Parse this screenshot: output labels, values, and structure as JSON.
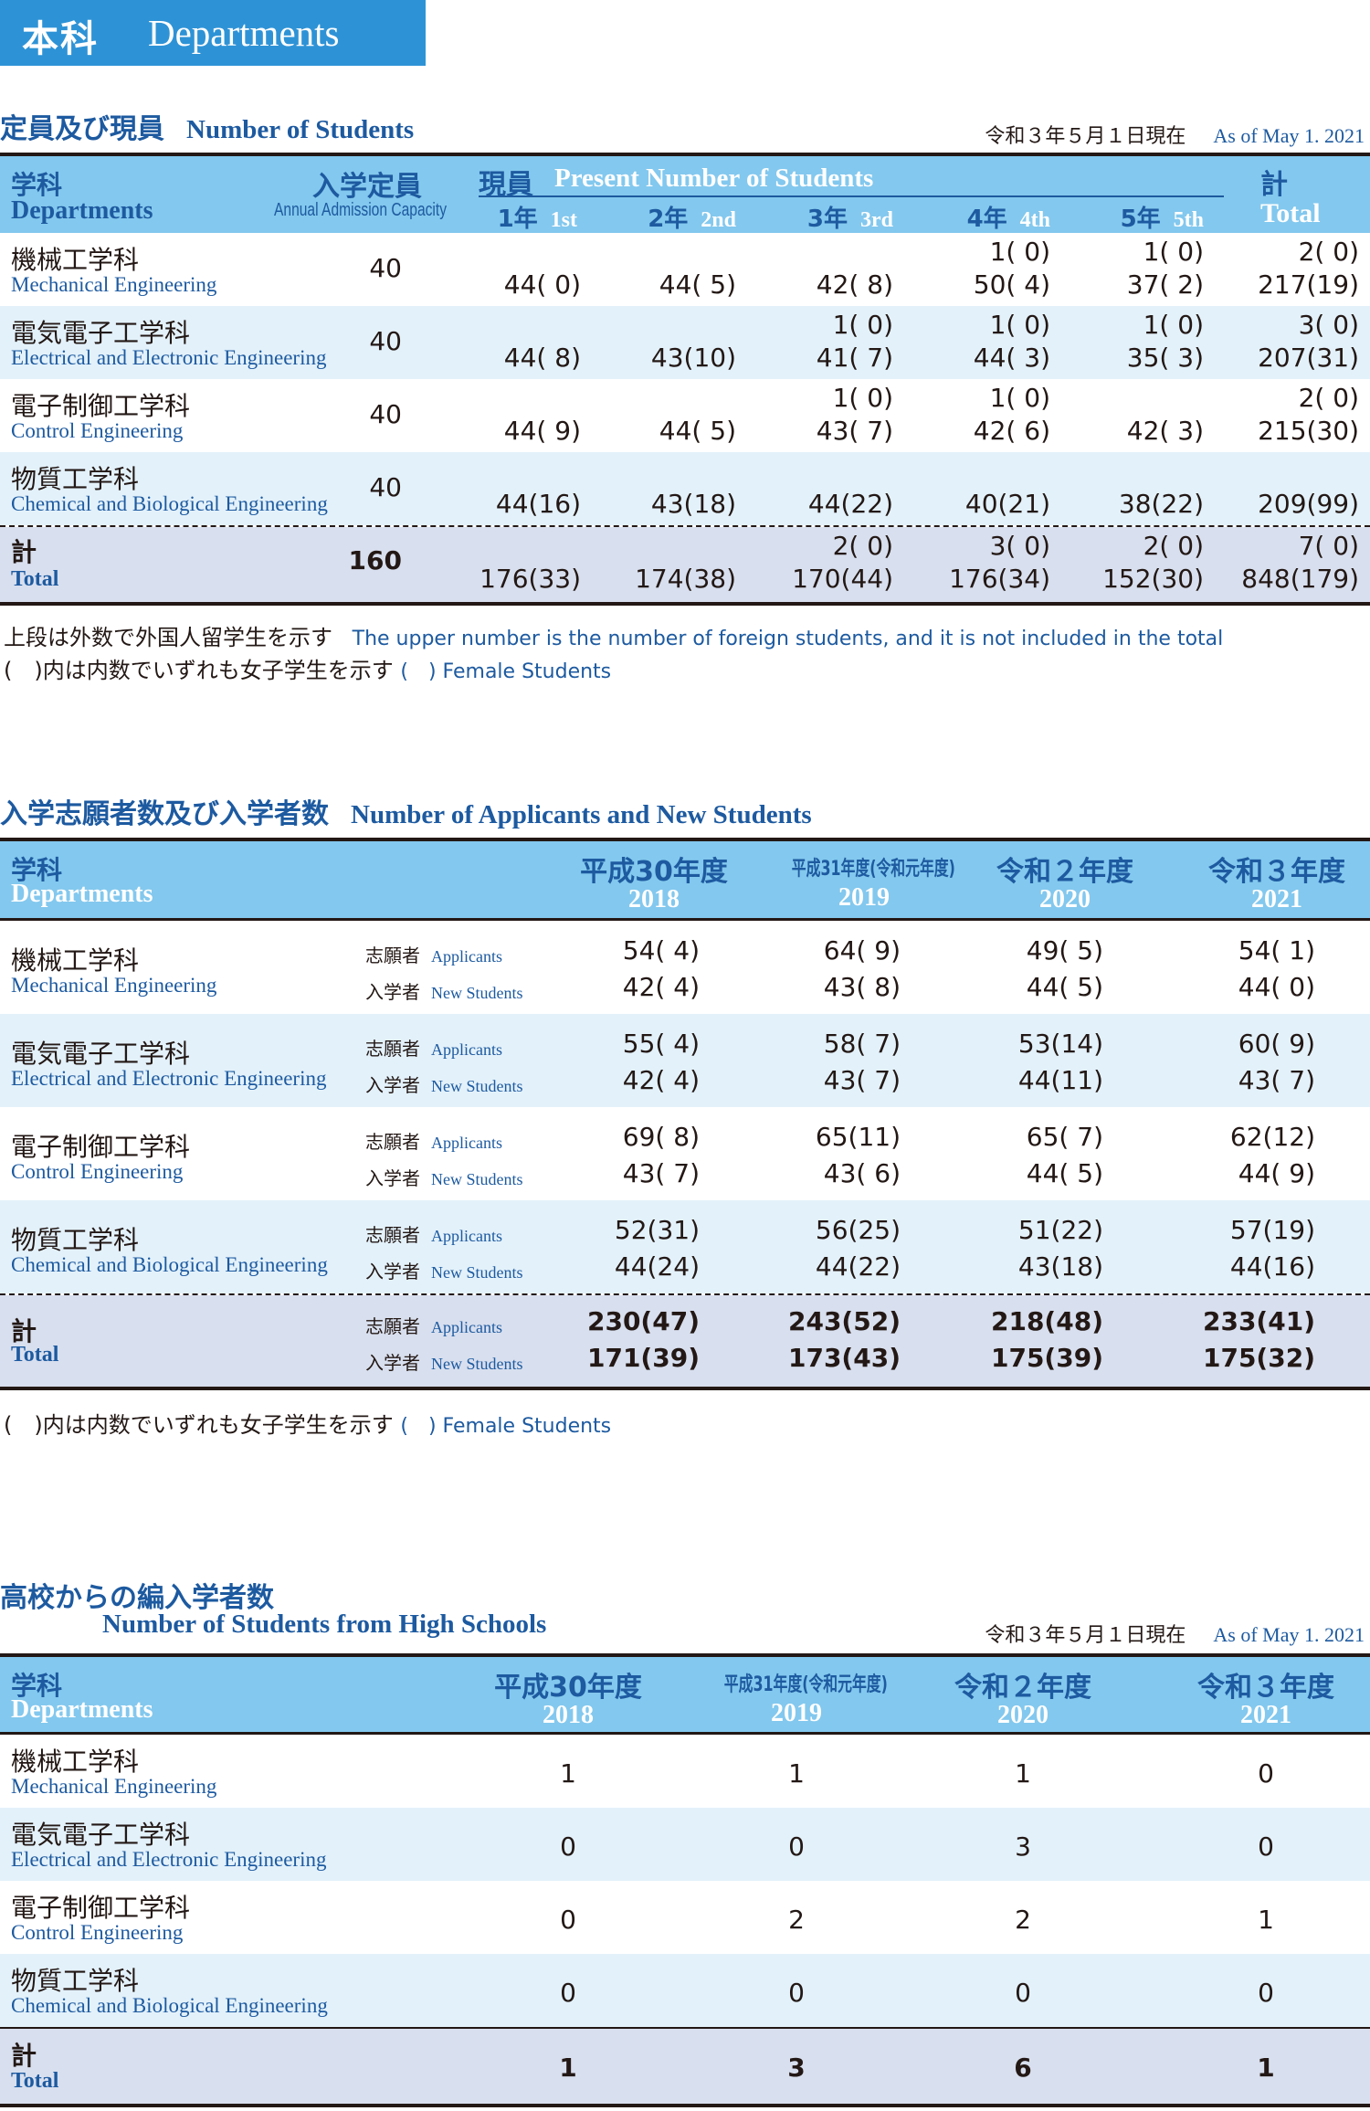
{
  "header": {
    "jp": "本科",
    "en": "Departments"
  },
  "students": {
    "title_jp": "定員及び現員",
    "title_en": "Number of Students",
    "asof_jp": "令和３年５月１日現在",
    "asof_en": "As of May 1. 2021",
    "head": {
      "dept_jp": "学科",
      "dept_en": "Departments",
      "cap_jp": "入学定員",
      "cap_en": "Annual Admission Capacity",
      "present_jp": "現員",
      "present_en": "Present Number of Students",
      "total_jp": "計",
      "total_en": "Total",
      "years": [
        {
          "jp": "1年",
          "en": "1st"
        },
        {
          "jp": "2年",
          "en": "2nd"
        },
        {
          "jp": "3年",
          "en": "3rd"
        },
        {
          "jp": "4年",
          "en": "4th"
        },
        {
          "jp": "5年",
          "en": "5th"
        }
      ]
    },
    "rows": [
      {
        "jp": "機械工学科",
        "en": "Mechanical Engineering",
        "cap": "40",
        "upper": [
          "",
          "",
          "",
          "1( 0)",
          "1( 0)",
          "2( 0)"
        ],
        "lower": [
          "44( 0)",
          "44( 5)",
          "42( 8)",
          "50( 4)",
          "37( 2)",
          "217(19)"
        ]
      },
      {
        "jp": "電気電子工学科",
        "en": "Electrical and Electronic Engineering",
        "cap": "40",
        "upper": [
          "",
          "",
          "1( 0)",
          "1( 0)",
          "1( 0)",
          "3( 0)"
        ],
        "lower": [
          "44( 8)",
          "43(10)",
          "41( 7)",
          "44( 3)",
          "35( 3)",
          "207(31)"
        ]
      },
      {
        "jp": "電子制御工学科",
        "en": "Control Engineering",
        "cap": "40",
        "upper": [
          "",
          "",
          "1( 0)",
          "1( 0)",
          "",
          "2( 0)"
        ],
        "lower": [
          "44( 9)",
          "44( 5)",
          "43( 7)",
          "42( 6)",
          "42( 3)",
          "215(30)"
        ]
      },
      {
        "jp": "物質工学科",
        "en": "Chemical and Biological Engineering",
        "cap": "40",
        "upper": [
          "",
          "",
          "",
          "",
          "",
          ""
        ],
        "lower": [
          "44(16)",
          "43(18)",
          "44(22)",
          "40(21)",
          "38(22)",
          "209(99)"
        ]
      }
    ],
    "total": {
      "jp": "計",
      "en": "Total",
      "cap": "160",
      "upper": [
        "",
        "",
        "2( 0)",
        "3( 0)",
        "2( 0)",
        "7( 0)"
      ],
      "lower": [
        "176(33)",
        "174(38)",
        "170(44)",
        "176(34)",
        "152(30)",
        "848(179)"
      ]
    },
    "note1_jp": "上段は外数で外国人留学生を示す",
    "note1_en": "The upper number is the number of foreign students, and it is not included in the total",
    "note2_jp": "(　)内は内数でいずれも女子学生を示す",
    "note2_en": "(　) Female Students"
  },
  "applicants": {
    "title_jp": "入学志願者数及び入学者数",
    "title_en": "Number of Applicants and New Students",
    "head": {
      "dept_jp": "学科",
      "dept_en": "Departments",
      "years": [
        {
          "jp": "平成30年度",
          "en": "2018"
        },
        {
          "jp": "平成31年度(令和元年度)",
          "en": "2019"
        },
        {
          "jp": "令和２年度",
          "en": "2020"
        },
        {
          "jp": "令和３年度",
          "en": "2021"
        }
      ]
    },
    "label_app_jp": "志願者",
    "label_app_en": "Applicants",
    "label_new_jp": "入学者",
    "label_new_en": "New Students",
    "rows": [
      {
        "jp": "機械工学科",
        "en": "Mechanical Engineering",
        "applicants": [
          "54( 4)",
          "64( 9)",
          "49( 5)",
          "54( 1)"
        ],
        "new": [
          "42( 4)",
          "43( 8)",
          "44( 5)",
          "44( 0)"
        ]
      },
      {
        "jp": "電気電子工学科",
        "en": "Electrical and Electronic Engineering",
        "applicants": [
          "55( 4)",
          "58( 7)",
          "53(14)",
          "60( 9)"
        ],
        "new": [
          "42( 4)",
          "43( 7)",
          "44(11)",
          "43( 7)"
        ]
      },
      {
        "jp": "電子制御工学科",
        "en": "Control Engineering",
        "applicants": [
          "69( 8)",
          "65(11)",
          "65( 7)",
          "62(12)"
        ],
        "new": [
          "43( 7)",
          "43( 6)",
          "44( 5)",
          "44( 9)"
        ]
      },
      {
        "jp": "物質工学科",
        "en": "Chemical and Biological Engineering",
        "applicants": [
          "52(31)",
          "56(25)",
          "51(22)",
          "57(19)"
        ],
        "new": [
          "44(24)",
          "44(22)",
          "43(18)",
          "44(16)"
        ]
      }
    ],
    "total": {
      "jp": "計",
      "en": "Total",
      "applicants": [
        "230(47)",
        "243(52)",
        "218(48)",
        "233(41)"
      ],
      "new": [
        "171(39)",
        "173(43)",
        "175(39)",
        "175(32)"
      ]
    },
    "note_jp": "(　)内は内数でいずれも女子学生を示す",
    "note_en": "(　) Female Students"
  },
  "transfer": {
    "title_jp": "高校からの編入学者数",
    "title_en": "Number of Students from High Schools",
    "asof_jp": "令和３年５月１日現在",
    "asof_en": "As of May 1. 2021",
    "head": {
      "dept_jp": "学科",
      "dept_en": "Departments",
      "years": [
        {
          "jp": "平成30年度",
          "en": "2018"
        },
        {
          "jp": "平成31年度(令和元年度)",
          "en": "2019"
        },
        {
          "jp": "令和２年度",
          "en": "2020"
        },
        {
          "jp": "令和３年度",
          "en": "2021"
        }
      ]
    },
    "rows": [
      {
        "jp": "機械工学科",
        "en": "Mechanical Engineering",
        "values": [
          "1",
          "1",
          "1",
          "0"
        ]
      },
      {
        "jp": "電気電子工学科",
        "en": "Electrical and Electronic Engineering",
        "values": [
          "0",
          "0",
          "3",
          "0"
        ]
      },
      {
        "jp": "電子制御工学科",
        "en": "Control Engineering",
        "values": [
          "0",
          "2",
          "2",
          "1"
        ]
      },
      {
        "jp": "物質工学科",
        "en": "Chemical and Biological Engineering",
        "values": [
          "0",
          "0",
          "0",
          "0"
        ]
      }
    ],
    "total": {
      "jp": "計",
      "en": "Total",
      "values": [
        "1",
        "3",
        "6",
        "1"
      ]
    }
  },
  "colors": {
    "header_blue": "#2e93d6",
    "table_head": "#83c8ee",
    "row_light": "#e3f1fa",
    "row_total": "#d8dfee",
    "text_blue": "#1d5aa0"
  }
}
